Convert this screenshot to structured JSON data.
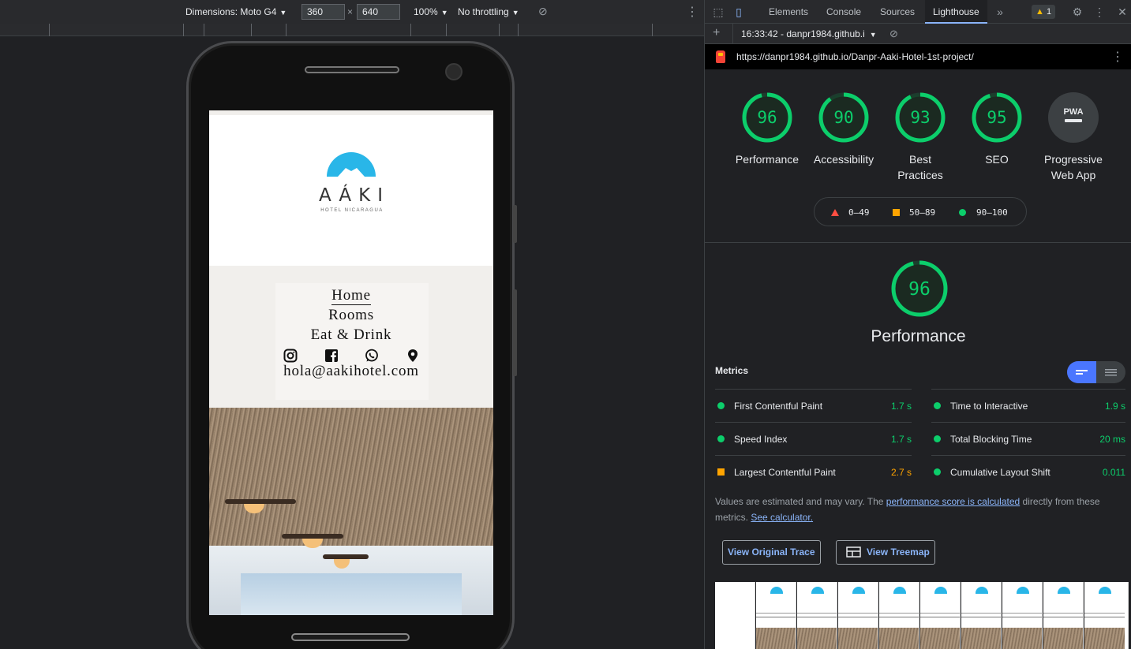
{
  "device_toolbar": {
    "dimensions_label": "Dimensions: Moto G4",
    "width": "360",
    "times": "×",
    "height": "640",
    "zoom": "100%",
    "throttling": "No throttling"
  },
  "site": {
    "logo_text": "AÁKI",
    "logo_sub": "HOTEL NICARAGUA",
    "nav": [
      "Home",
      "Rooms",
      "Eat & Drink"
    ],
    "email": "hola@aakihotel.com",
    "social_icons": [
      "instagram-icon",
      "facebook-icon",
      "whatsapp-icon",
      "location-pin-icon"
    ],
    "brand_color": "#29b6e8"
  },
  "devtools": {
    "tabs": [
      "Elements",
      "Console",
      "Sources",
      "Lighthouse"
    ],
    "active_tab": "Lighthouse",
    "more": "»",
    "warning_count": "1",
    "report_selector": "16:33:42 - danpr1984.github.i",
    "url": "https://danpr1984.github.io/Danpr-Aaki-Hotel-1st-project/"
  },
  "lighthouse": {
    "categories": [
      {
        "score": "96",
        "label": "Performance"
      },
      {
        "score": "90",
        "label": "Accessibility"
      },
      {
        "score": "93",
        "label": "Best Practices"
      },
      {
        "score": "95",
        "label": "SEO"
      }
    ],
    "pwa": {
      "badge": "PWA",
      "label": "Progressive Web App"
    },
    "legend": {
      "fail": "0–49",
      "average": "50–89",
      "pass": "90–100"
    },
    "colors": {
      "pass": "#0cce6b",
      "average": "#ffa400",
      "fail": "#ff4e42"
    },
    "performance": {
      "score": "96",
      "title": "Performance",
      "metrics_heading": "Metrics",
      "metrics": [
        {
          "name": "First Contentful Paint",
          "value": "1.7 s",
          "status": "pass"
        },
        {
          "name": "Time to Interactive",
          "value": "1.9 s",
          "status": "pass"
        },
        {
          "name": "Speed Index",
          "value": "1.7 s",
          "status": "pass"
        },
        {
          "name": "Total Blocking Time",
          "value": "20 ms",
          "status": "pass"
        },
        {
          "name": "Largest Contentful Paint",
          "value": "2.7 s",
          "status": "average"
        },
        {
          "name": "Cumulative Layout Shift",
          "value": "0.011",
          "status": "pass"
        }
      ],
      "note_1": "Values are estimated and may vary. The ",
      "note_link_1": "performance score is calculated",
      "note_2": " directly from these metrics. ",
      "note_link_2": "See calculator.",
      "view_trace": "View Original Trace",
      "view_treemap": "View Treemap"
    }
  }
}
